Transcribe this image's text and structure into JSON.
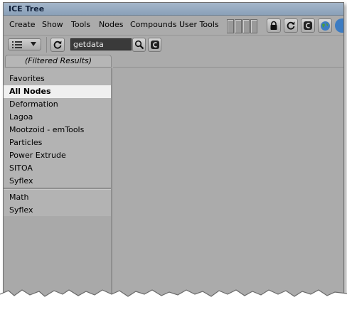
{
  "window": {
    "title": "ICE Tree"
  },
  "menu": {
    "items": [
      {
        "label": "Create"
      },
      {
        "label": "Show"
      },
      {
        "label": "Tools"
      },
      {
        "label": "Nodes"
      },
      {
        "label": "Compounds"
      },
      {
        "label": "User Tools"
      }
    ]
  },
  "search": {
    "value": "getdata"
  },
  "filter_tab": {
    "label": "(Filtered Results)"
  },
  "sidebar": {
    "categories": [
      {
        "label": "Favorites"
      },
      {
        "label": "All Nodes",
        "selected": true
      },
      {
        "label": "Deformation"
      },
      {
        "label": "Lagoa"
      },
      {
        "label": "Mootzoid - emTools"
      },
      {
        "label": "Particles"
      },
      {
        "label": "Power Extrude"
      },
      {
        "label": "SITOA"
      },
      {
        "label": "Syflex"
      }
    ],
    "tasks": [
      {
        "label": "Math"
      },
      {
        "label": "Syflex"
      }
    ]
  },
  "colors": {
    "title_bar": "#8aa0b8",
    "panel": "#ababab",
    "selected_item": "#f0f0f0",
    "search_bg": "#3a3a3a"
  },
  "icons": [
    "lock-icon",
    "refresh-icon",
    "clear-icon",
    "globe-icon",
    "list-icon",
    "magnifier-icon"
  ]
}
